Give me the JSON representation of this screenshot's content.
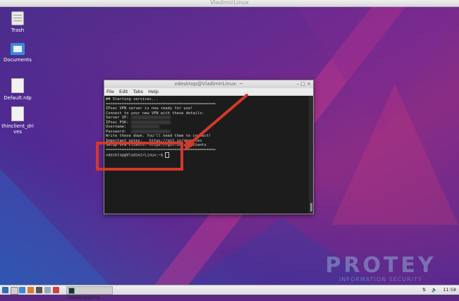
{
  "window": {
    "title": "VladimirLinux"
  },
  "desktop": {
    "icons": [
      {
        "label": "Trash"
      },
      {
        "label": "Documents"
      },
      {
        "label": "Default.rdp"
      },
      {
        "label": "thinclient_drives"
      }
    ]
  },
  "terminal": {
    "title": "vdesktop@VladimirLinux: ~",
    "window_buttons": "– □ ×",
    "menu": [
      "File",
      "Edit",
      "Tabs",
      "Help"
    ],
    "lines": [
      "",
      "## Starting services...",
      "",
      "",
      "================================================",
      "",
      "IPsec VPN server is now ready for use!",
      "",
      "Connect to your new VPN with these details:",
      "",
      "Server IP: ",
      "IPsec PSK: ",
      "Username:  ",
      "Password:  ",
      "",
      "Write these down. You'll need them to connect!",
      "",
      "Important notes:   https://git.io/vpnnotes",
      "Setup VPN clients: https://git.io/vpnclients",
      "",
      "================================================",
      ""
    ],
    "prompt": "vdesktop@VladimirLinux:~$ "
  },
  "watermark": {
    "main": "PROTEY",
    "sub": "INFORMATION SECURITY"
  },
  "taskbar": {
    "task_label": "vdesktop@Vla...",
    "clock": "11:58",
    "volume_icon": "speaker-icon"
  },
  "colors": {
    "highlight": "#d4382a",
    "terminal_bg": "#1c1c1c"
  }
}
